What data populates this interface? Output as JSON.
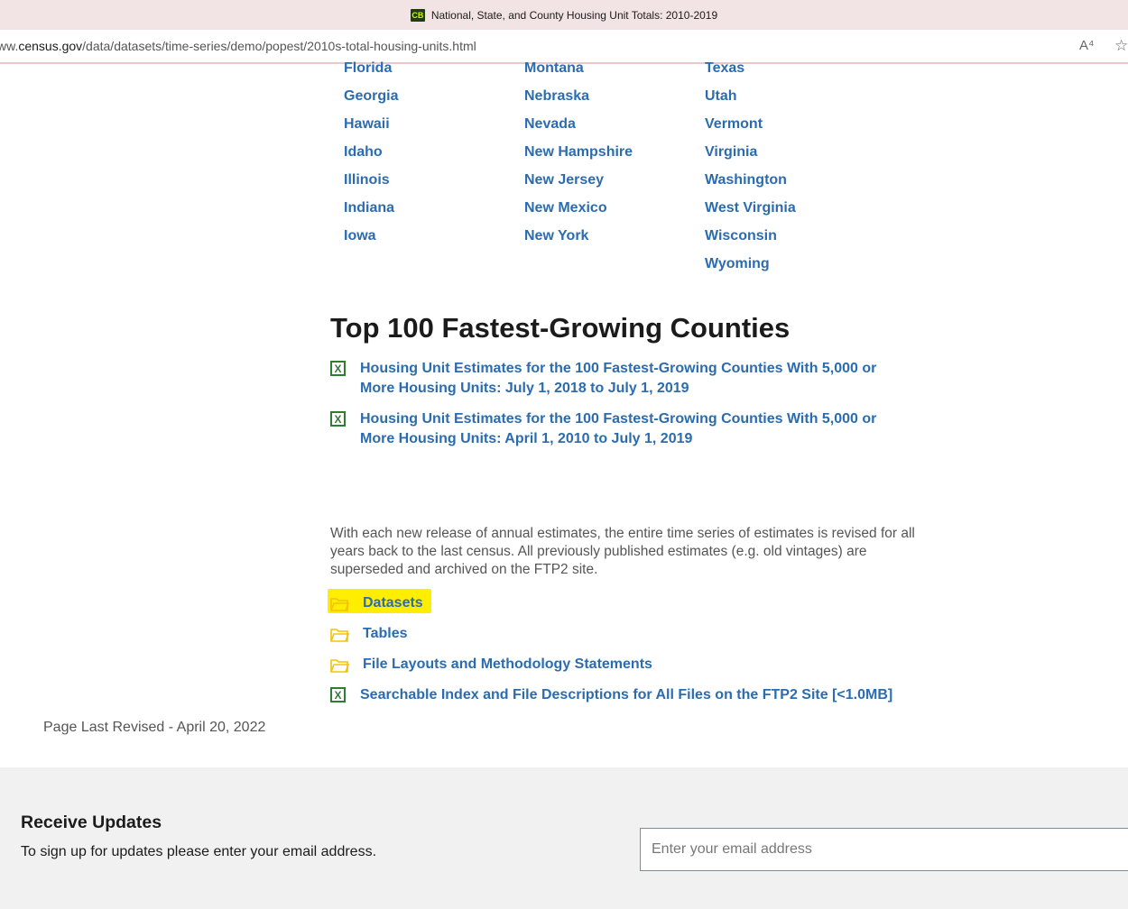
{
  "browser": {
    "tab_title": "National, State, and County Housing Unit Totals: 2010-2019",
    "favicon_text": "CB",
    "url_prefix": "ww.",
    "url_host": "census.gov",
    "url_path": "/data/datasets/time-series/demo/popest/2010s-total-housing-units.html",
    "read_aloud_glyph": "A⁴",
    "favorite_glyph": "☆"
  },
  "states": {
    "col1": [
      "Florida",
      "Georgia",
      "Hawaii",
      "Idaho",
      "Illinois",
      "Indiana",
      "Iowa"
    ],
    "col2": [
      "Montana",
      "Nebraska",
      "Nevada",
      "New Hampshire",
      "New Jersey",
      "New Mexico",
      "New York"
    ],
    "col3": [
      "Texas",
      "Utah",
      "Vermont",
      "Virginia",
      "Washington",
      "West Virginia",
      "Wisconsin",
      "Wyoming"
    ]
  },
  "section": {
    "heading": "Top 100 Fastest-Growing Counties",
    "links": [
      "Housing Unit Estimates for the 100 Fastest-Growing Counties With 5,000 or More Housing Units: July 1, 2018 to July 1, 2019",
      "Housing Unit Estimates for the 100 Fastest-Growing Counties With 5,000 or More Housing Units: April 1, 2010 to July 1, 2019"
    ]
  },
  "revision_note": "With each new release of annual estimates, the entire time series of estimates is revised for all years back to the last census. All previously published estimates (e.g. old vintages) are superseded and archived on the FTP2 site.",
  "ftp_links": {
    "datasets": "Datasets",
    "tables": "Tables",
    "layouts": "File Layouts and Methodology Statements",
    "index": "Searchable Index and File Descriptions for All Files on the FTP2 Site [<1.0MB]"
  },
  "xls_icon_glyph": "X",
  "page_revised": "Page Last Revised - April 20, 2022",
  "footer": {
    "title": "Receive Updates",
    "subtitle": "To sign up for updates please enter your email address.",
    "email_placeholder": "Enter your email address"
  },
  "colors": {
    "link": "#2b6cb0",
    "highlight": "#ffee00",
    "excel_green": "#2e7d32",
    "folder_yellow": "#f4c20d"
  }
}
